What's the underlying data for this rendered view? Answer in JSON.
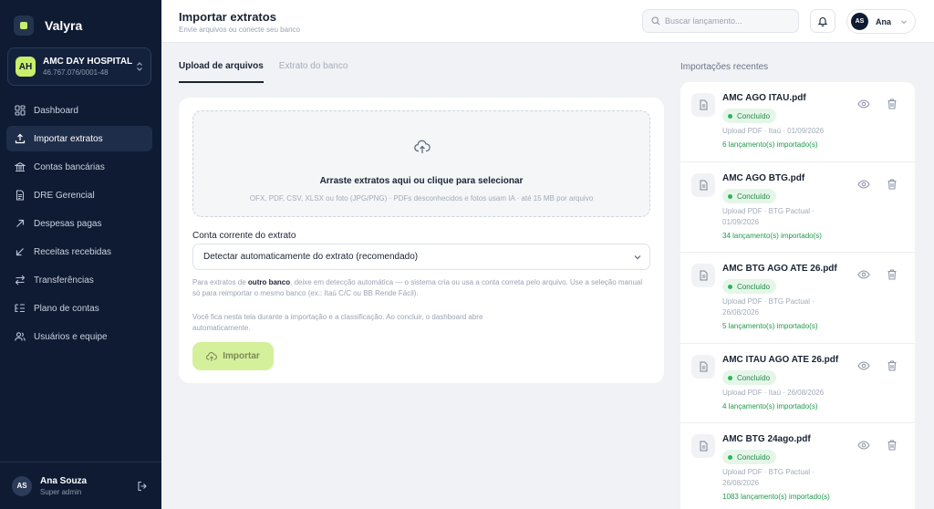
{
  "brand": {
    "name": "Valyra"
  },
  "company": {
    "initials": "AH",
    "name": "AMC DAY HOSPITAL",
    "cnpj": "46.767.076/0001-48"
  },
  "nav": [
    {
      "label": "Dashboard",
      "icon": "dashboard-icon"
    },
    {
      "label": "Importar extratos",
      "icon": "upload-icon",
      "active": true
    },
    {
      "label": "Contas bancárias",
      "icon": "bank-icon"
    },
    {
      "label": "DRE Gerencial",
      "icon": "report-icon"
    },
    {
      "label": "Despesas pagas",
      "icon": "arrow-up-right-icon"
    },
    {
      "label": "Receitas recebidas",
      "icon": "arrow-down-left-icon"
    },
    {
      "label": "Transferências",
      "icon": "transfer-icon"
    },
    {
      "label": "Plano de contas",
      "icon": "list-tree-icon"
    },
    {
      "label": "Usuários e equipe",
      "icon": "users-icon"
    }
  ],
  "sidebar_user": {
    "initials": "AS",
    "name": "Ana Souza",
    "role": "Super admin"
  },
  "header": {
    "title": "Importar extratos",
    "subtitle": "Envie arquivos ou conecte seu banco",
    "search_placeholder": "Buscar lançamento...",
    "user_initials": "AS",
    "user_name": "Ana"
  },
  "tabs": [
    {
      "label": "Upload de arquivos",
      "active": true
    },
    {
      "label": "Extrato do banco",
      "active": false
    }
  ],
  "upload": {
    "dropzone_title": "Arraste extratos aqui ou clique para selecionar",
    "dropzone_hint": "OFX, PDF, CSV, XLSX ou foto (JPG/PNG) · PDFs desconhecidos e fotos usam IA · até 15 MB por arquivo",
    "account_label": "Conta corrente do extrato",
    "account_value": "Detectar automaticamente do extrato (recomendado)",
    "help_pre": "Para extratos de ",
    "help_bold": "outro banco",
    "help_post": ", deixe em detecção automática — o sistema cria ou usa a conta correta pelo arquivo. Use a seleção manual só para reimportar o mesmo banco (ex.: Itaú C/C ou BB Rende Fácil).",
    "help2": "Você fica nesta tela durante a importação e a classificação. Ao concluir, o dashboard abre automaticamente.",
    "import_label": "Importar"
  },
  "recent": {
    "title": "Importações recentes",
    "items": [
      {
        "name": "AMC AGO ITAU.pdf",
        "status": "Concluído",
        "meta": "Upload PDF · Itaú · 01/09/2026",
        "count": "6 lançamento(s) importado(s)"
      },
      {
        "name": "AMC AGO BTG.pdf",
        "status": "Concluído",
        "meta": "Upload PDF · BTG Pactual · 01/09/2026",
        "count": "34 lançamento(s) importado(s)"
      },
      {
        "name": "AMC BTG AGO ATE 26.pdf",
        "status": "Concluído",
        "meta": "Upload PDF · BTG Pactual · 26/08/2026",
        "count": "5 lançamento(s) importado(s)"
      },
      {
        "name": "AMC ITAU AGO ATE 26.pdf",
        "status": "Concluído",
        "meta": "Upload PDF · Itaú · 26/08/2026",
        "count": "4 lançamento(s) importado(s)"
      },
      {
        "name": "AMC BTG 24ago.pdf",
        "status": "Concluído",
        "meta": "Upload PDF · BTG Pactual · 26/08/2026",
        "count": "1083 lançamento(s) importado(s)"
      }
    ]
  },
  "colors": {
    "sidebar": "#0f1b33",
    "accent": "#c9ef6b",
    "success": "#1f8a45"
  }
}
